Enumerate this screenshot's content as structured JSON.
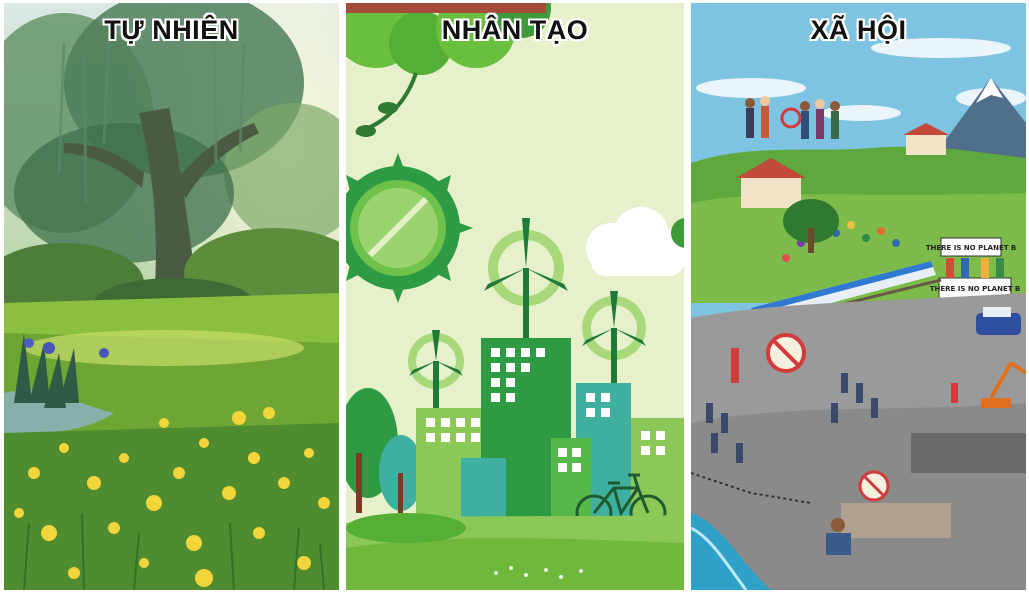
{
  "panels": [
    {
      "title": "TỰ NHIÊN"
    },
    {
      "title": "NHÂN TẠO"
    },
    {
      "title": "XÃ HỘI"
    }
  ],
  "signs": {
    "planet_b": "THERE IS NO PLANET B",
    "planet_b_small": "THERE IS NO PLANET B"
  },
  "colors": {
    "nature_sky": "#cfe3c8",
    "nature_grass": "#7fb43a",
    "artificial_bg": "#e6f1cc",
    "artificial_green": "#2e9a48",
    "social_sky": "#7fc3e2",
    "social_ground": "#8f8f8f"
  }
}
